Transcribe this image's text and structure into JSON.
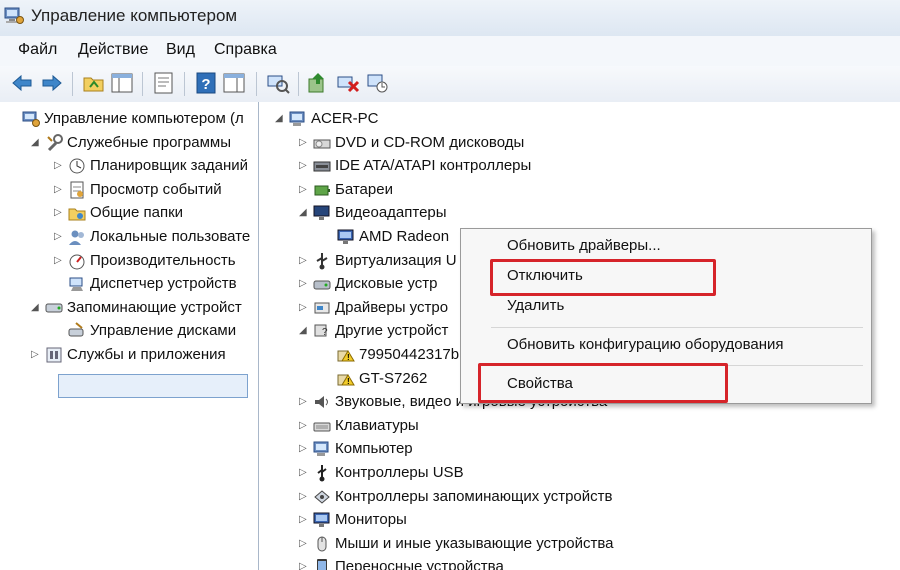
{
  "window": {
    "title": "Управление компьютером"
  },
  "menu": {
    "items": [
      "Файл",
      "Действие",
      "Вид",
      "Справка"
    ]
  },
  "toolbar": {
    "buttons": [
      "back-arrow-icon",
      "forward-arrow-icon",
      "up-folder-icon",
      "show-hide-tree-icon",
      "properties-icon",
      "help-icon",
      "show-hide-action-pane-icon",
      "scan-hardware-icon",
      "update-driver-icon",
      "uninstall-device-icon",
      "disable-device-icon"
    ]
  },
  "left_tree": {
    "items": [
      {
        "label": "Управление компьютером (л",
        "icon": "computer-management-icon",
        "level": 0,
        "twisty": ""
      },
      {
        "label": "Служебные программы",
        "icon": "tools-icon",
        "level": 1,
        "twisty": "expanded"
      },
      {
        "label": "Планировщик заданий",
        "icon": "task-scheduler-icon",
        "level": 2,
        "twisty": "collapsed"
      },
      {
        "label": "Просмотр событий",
        "icon": "event-viewer-icon",
        "level": 2,
        "twisty": "collapsed"
      },
      {
        "label": "Общие папки",
        "icon": "shared-folders-icon",
        "level": 2,
        "twisty": "collapsed"
      },
      {
        "label": "Локальные пользовате",
        "icon": "local-users-icon",
        "level": 2,
        "twisty": "collapsed"
      },
      {
        "label": "Производительность",
        "icon": "performance-icon",
        "level": 2,
        "twisty": "collapsed"
      },
      {
        "label": "Диспетчер устройств",
        "icon": "device-manager-icon",
        "level": 2,
        "twisty": "",
        "selected": true
      },
      {
        "label": "Запоминающие устройст",
        "icon": "storage-icon",
        "level": 1,
        "twisty": "expanded"
      },
      {
        "label": "Управление дисками",
        "icon": "disk-management-icon",
        "level": 2,
        "twisty": ""
      },
      {
        "label": "Службы и приложения",
        "icon": "services-icon",
        "level": 1,
        "twisty": "collapsed"
      }
    ]
  },
  "device_tree": {
    "items": [
      {
        "label": "ACER-PC",
        "icon": "computer-icon",
        "level": 0,
        "twisty": "expanded"
      },
      {
        "label": "DVD и CD-ROM дисководы",
        "icon": "dvd-drive-icon",
        "level": 1,
        "twisty": "collapsed"
      },
      {
        "label": "IDE ATA/ATAPI контроллеры",
        "icon": "ide-controller-icon",
        "level": 1,
        "twisty": "collapsed"
      },
      {
        "label": "Батареи",
        "icon": "battery-icon",
        "level": 1,
        "twisty": "collapsed"
      },
      {
        "label": "Видеоадаптеры",
        "icon": "display-adapter-icon",
        "level": 1,
        "twisty": "expanded"
      },
      {
        "label": "AMD Radeon",
        "icon": "monitor-icon",
        "level": 2,
        "twisty": ""
      },
      {
        "label": "Виртуализация U",
        "icon": "usb-virtualization-icon",
        "level": 1,
        "twisty": "collapsed"
      },
      {
        "label": "Дисковые устр",
        "icon": "disk-drive-icon",
        "level": 1,
        "twisty": "collapsed"
      },
      {
        "label": "Драйверы устро",
        "icon": "drivers-icon",
        "level": 1,
        "twisty": "collapsed"
      },
      {
        "label": "Другие устройст",
        "icon": "other-devices-icon",
        "level": 1,
        "twisty": "expanded"
      },
      {
        "label": "79950442317b",
        "icon": "unknown-device-icon",
        "level": 2,
        "twisty": ""
      },
      {
        "label": "GT-S7262",
        "icon": "unknown-device-icon",
        "level": 2,
        "twisty": ""
      },
      {
        "label": "Звуковые, видео и игровые устройства",
        "icon": "sound-icon",
        "level": 1,
        "twisty": "collapsed"
      },
      {
        "label": "Клавиатуры",
        "icon": "keyboard-icon",
        "level": 1,
        "twisty": "collapsed"
      },
      {
        "label": "Компьютер",
        "icon": "computer-icon",
        "level": 1,
        "twisty": "collapsed"
      },
      {
        "label": "Контроллеры USB",
        "icon": "usb-controller-icon",
        "level": 1,
        "twisty": "collapsed"
      },
      {
        "label": "Контроллеры запоминающих устройств",
        "icon": "storage-controller-icon",
        "level": 1,
        "twisty": "collapsed"
      },
      {
        "label": "Мониторы",
        "icon": "monitor-icon",
        "level": 1,
        "twisty": "collapsed"
      },
      {
        "label": "Мыши и иные указывающие устройства",
        "icon": "mouse-icon",
        "level": 1,
        "twisty": "collapsed"
      },
      {
        "label": "Переносные устройства",
        "icon": "portable-devices-icon",
        "level": 1,
        "twisty": "collapsed"
      }
    ]
  },
  "context_menu": {
    "items": [
      {
        "label": "Обновить драйверы...",
        "highlighted": false
      },
      {
        "label": "Отключить",
        "highlighted": true
      },
      {
        "label": "Удалить",
        "highlighted": false
      },
      {
        "label": "Обновить конфигурацию оборудования",
        "highlighted": false
      },
      {
        "label": "Свойства",
        "highlighted": true
      }
    ]
  },
  "colors": {
    "highlight_box": "#d6242a",
    "selection": "#e6effa",
    "pane_border": "#a9b7c9"
  }
}
